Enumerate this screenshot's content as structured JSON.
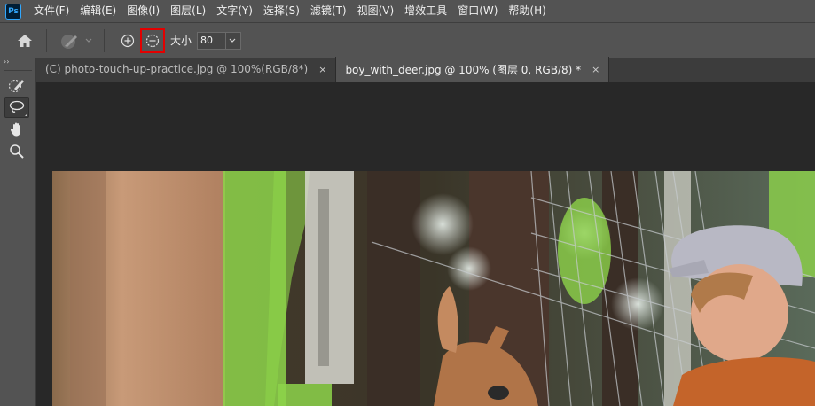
{
  "app": {
    "logo_text": "Ps"
  },
  "menu": [
    "文件(F)",
    "编辑(E)",
    "图像(I)",
    "图层(L)",
    "文字(Y)",
    "选择(S)",
    "滤镜(T)",
    "视图(V)",
    "增效工具",
    "窗口(W)",
    "帮助(H)"
  ],
  "options": {
    "size_label": "大小",
    "size_value": "80"
  },
  "tabs": [
    {
      "label": "(C) photo-touch-up-practice.jpg @ 100%(RGB/8*)",
      "close": "×",
      "active": false
    },
    {
      "label": "boy_with_deer.jpg @ 100% (图层 0, RGB/8) *",
      "close": "×",
      "active": true
    }
  ],
  "toolbar": {
    "collapse": "››"
  },
  "colors": {
    "chrome": "#535353",
    "workspace": "#282828",
    "mask_green": "#8dd34a",
    "highlight": "#e30000"
  }
}
